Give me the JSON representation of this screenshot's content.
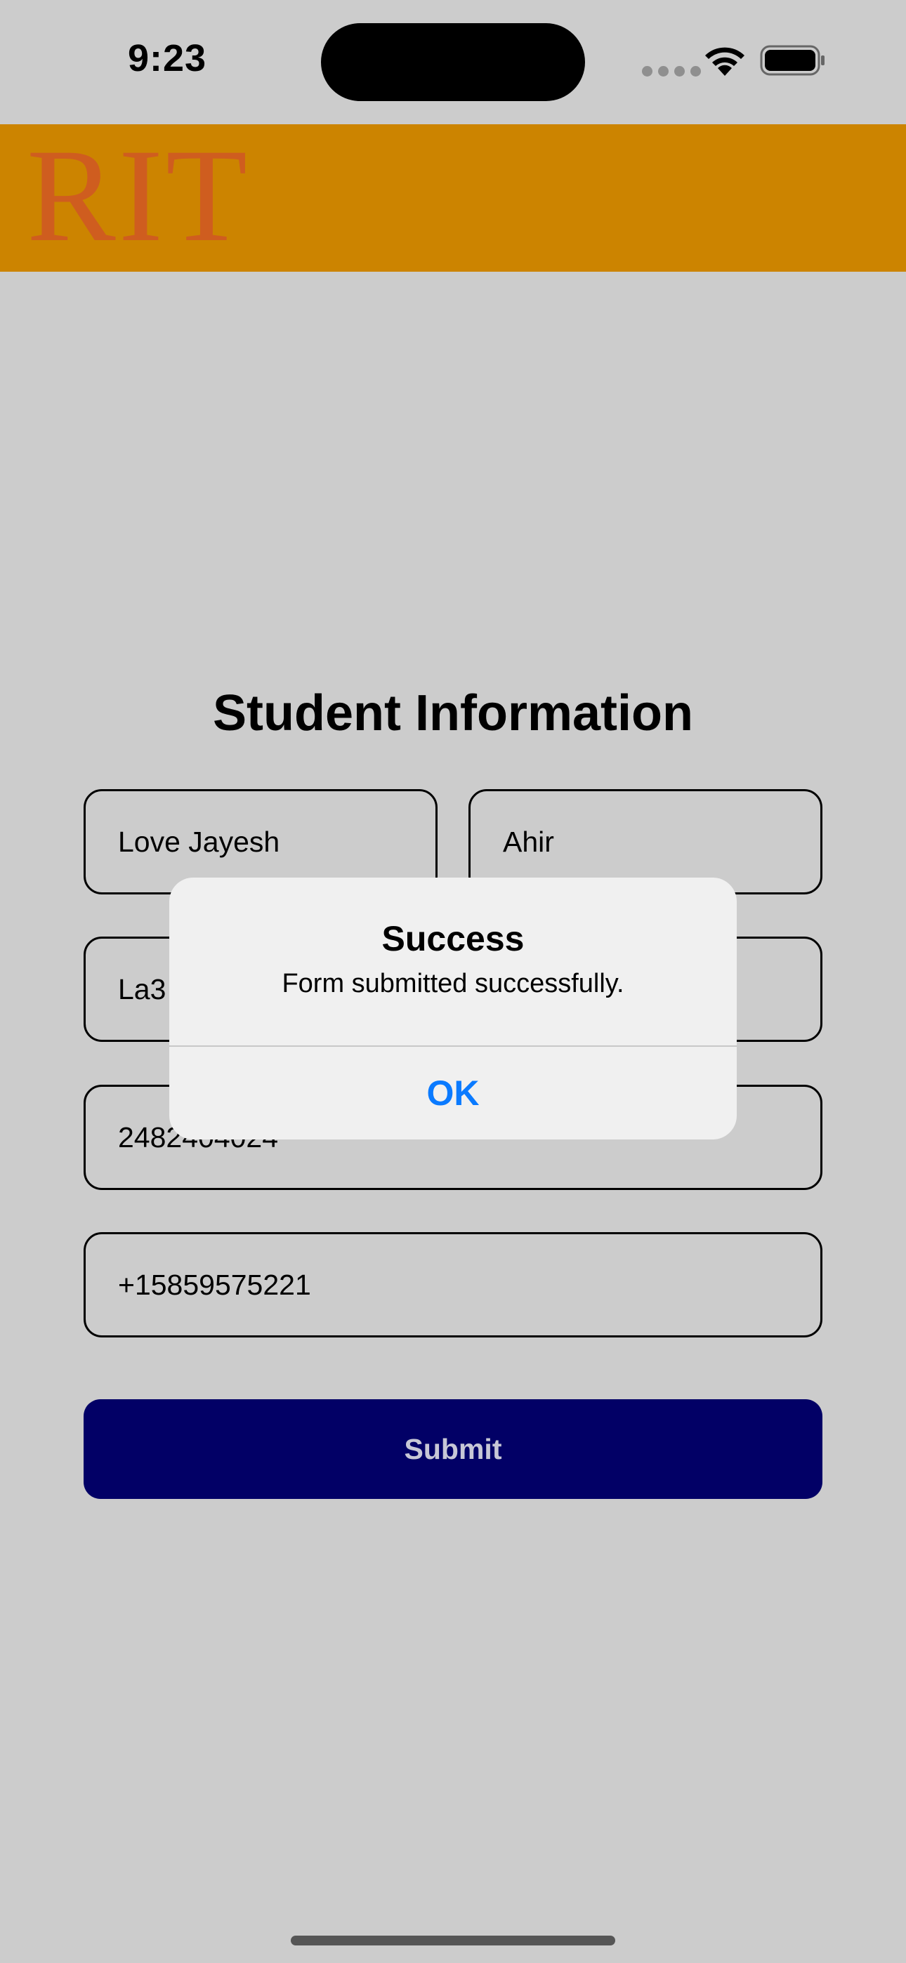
{
  "status_bar": {
    "time": "9:23",
    "icons": [
      "signal-icon",
      "wifi-icon",
      "battery-icon"
    ]
  },
  "header": {
    "logo": "RIT",
    "background_color": "#cc8400",
    "logo_color": "#cf5d1f"
  },
  "form": {
    "title": "Student Information",
    "fields": {
      "first_name": "Love Jayesh",
      "last_name": "Ahir",
      "third": "La3",
      "fourth": "",
      "id_number": "2482404024",
      "phone": "+15859575221"
    },
    "submit_label": "Submit",
    "submit_color": "#020066"
  },
  "alert": {
    "title": "Success",
    "message": "Form submitted successfully.",
    "ok_label": "OK",
    "ok_color": "#0a7aff"
  }
}
